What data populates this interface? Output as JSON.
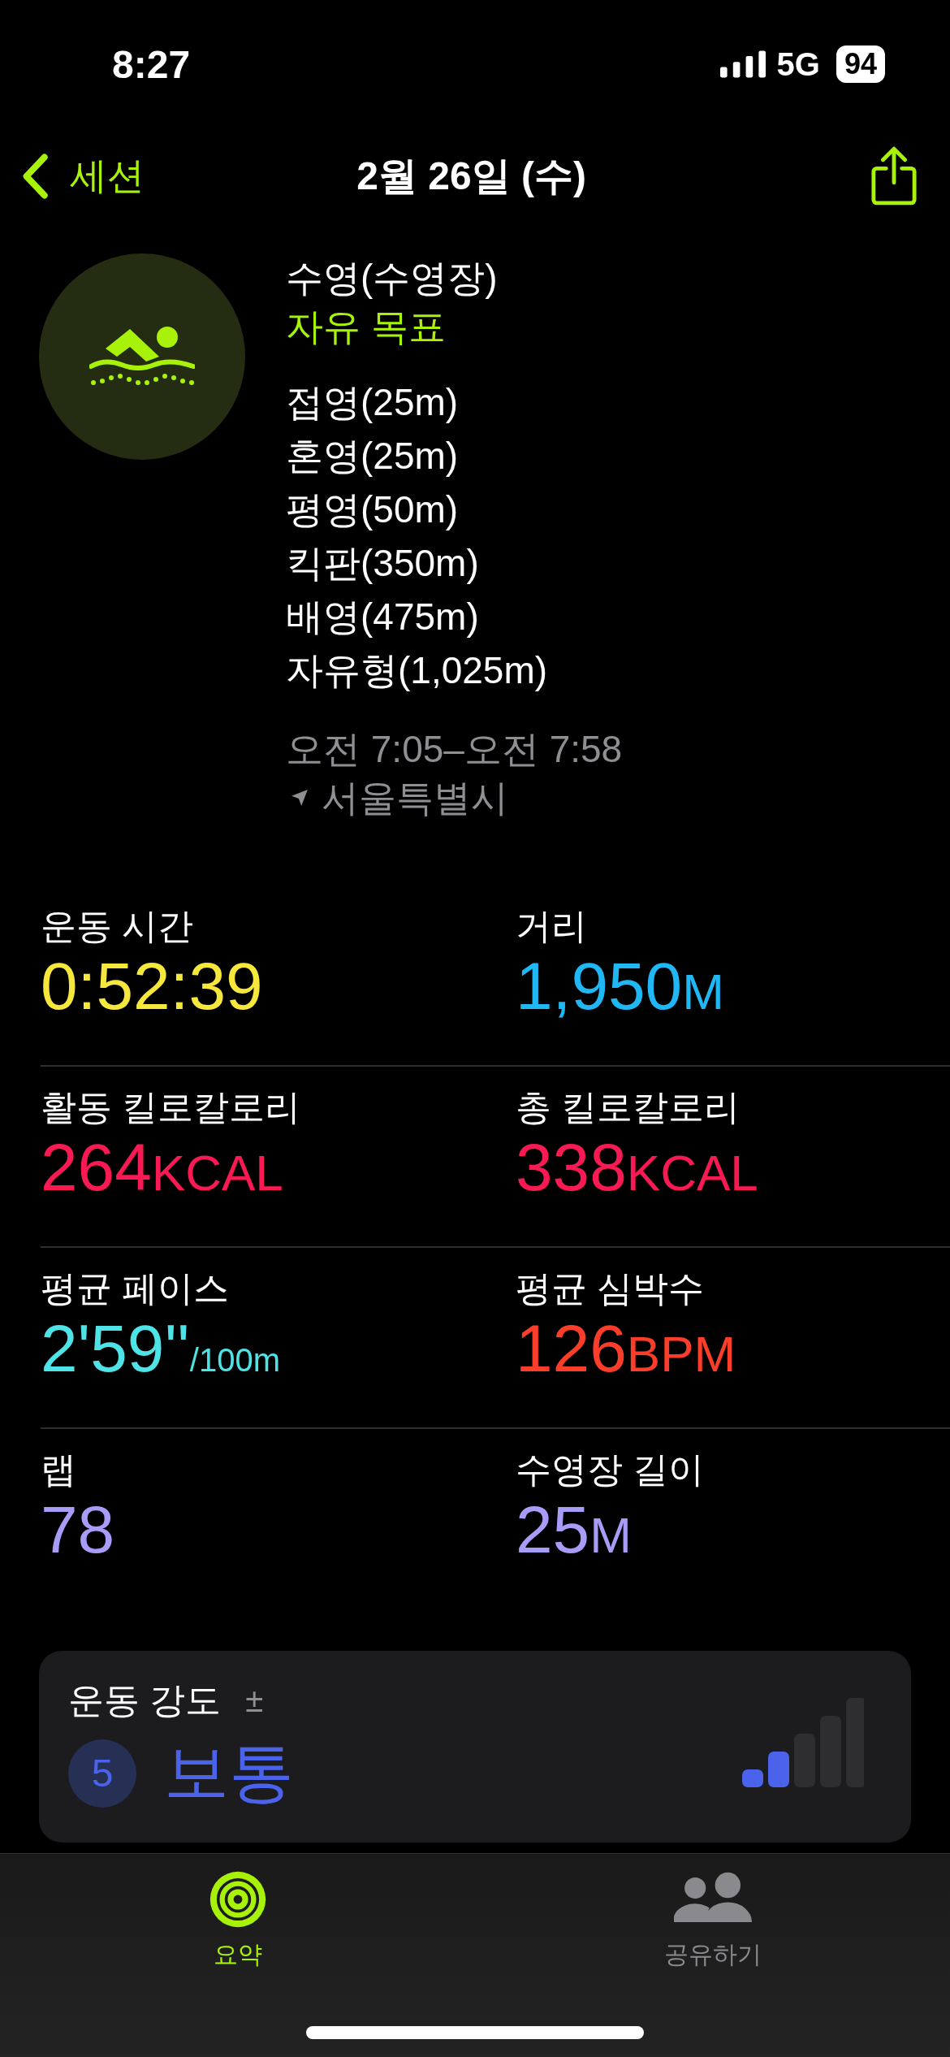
{
  "status_bar": {
    "time": "8:27",
    "network": "5G",
    "battery": "94"
  },
  "nav": {
    "back_label": "세션",
    "title": "2월 26일 (수)"
  },
  "workout": {
    "type": "수영(수영장)",
    "goal": "자유 목표",
    "strokes": [
      "접영(25m)",
      "혼영(25m)",
      "평영(50m)",
      "킥판(350m)",
      "배영(475m)",
      "자유형(1,025m)"
    ],
    "time_range": "오전 7:05–오전 7:58",
    "location": "서울특별시"
  },
  "stats": [
    {
      "kind": "plain",
      "label": "운동 시간",
      "value": "0:52:39",
      "color": "#f5e73c"
    },
    {
      "kind": "unit",
      "label": "거리",
      "value": "1,950",
      "unit": "M",
      "color": "#1fb8f5"
    },
    {
      "kind": "unit",
      "label": "활동 킬로칼로리",
      "value": "264",
      "unit": "KCAL",
      "color": "#fa1a53"
    },
    {
      "kind": "unit",
      "label": "총 킬로칼로리",
      "value": "338",
      "unit": "KCAL",
      "color": "#fa1a53"
    },
    {
      "kind": "pace",
      "label": "평균 페이스",
      "value": "2'59''",
      "unit": "/100m",
      "color": "#4ee3e6"
    },
    {
      "kind": "unit",
      "label": "평균 심박수",
      "value": "126",
      "unit": "BPM",
      "color": "#fc3d2a"
    },
    {
      "kind": "plain",
      "label": "랩",
      "value": "78",
      "color": "#a79cf7"
    },
    {
      "kind": "unit",
      "label": "수영장 길이",
      "value": "25",
      "unit": "M",
      "color": "#a79cf7"
    }
  ],
  "effort": {
    "title": "운동 강도",
    "adjust": "±",
    "score": "5",
    "rating": "보통",
    "level": 0.4
  },
  "tabs": [
    {
      "label": "요약",
      "selected": true
    },
    {
      "label": "공유하기",
      "selected": false
    }
  ]
}
